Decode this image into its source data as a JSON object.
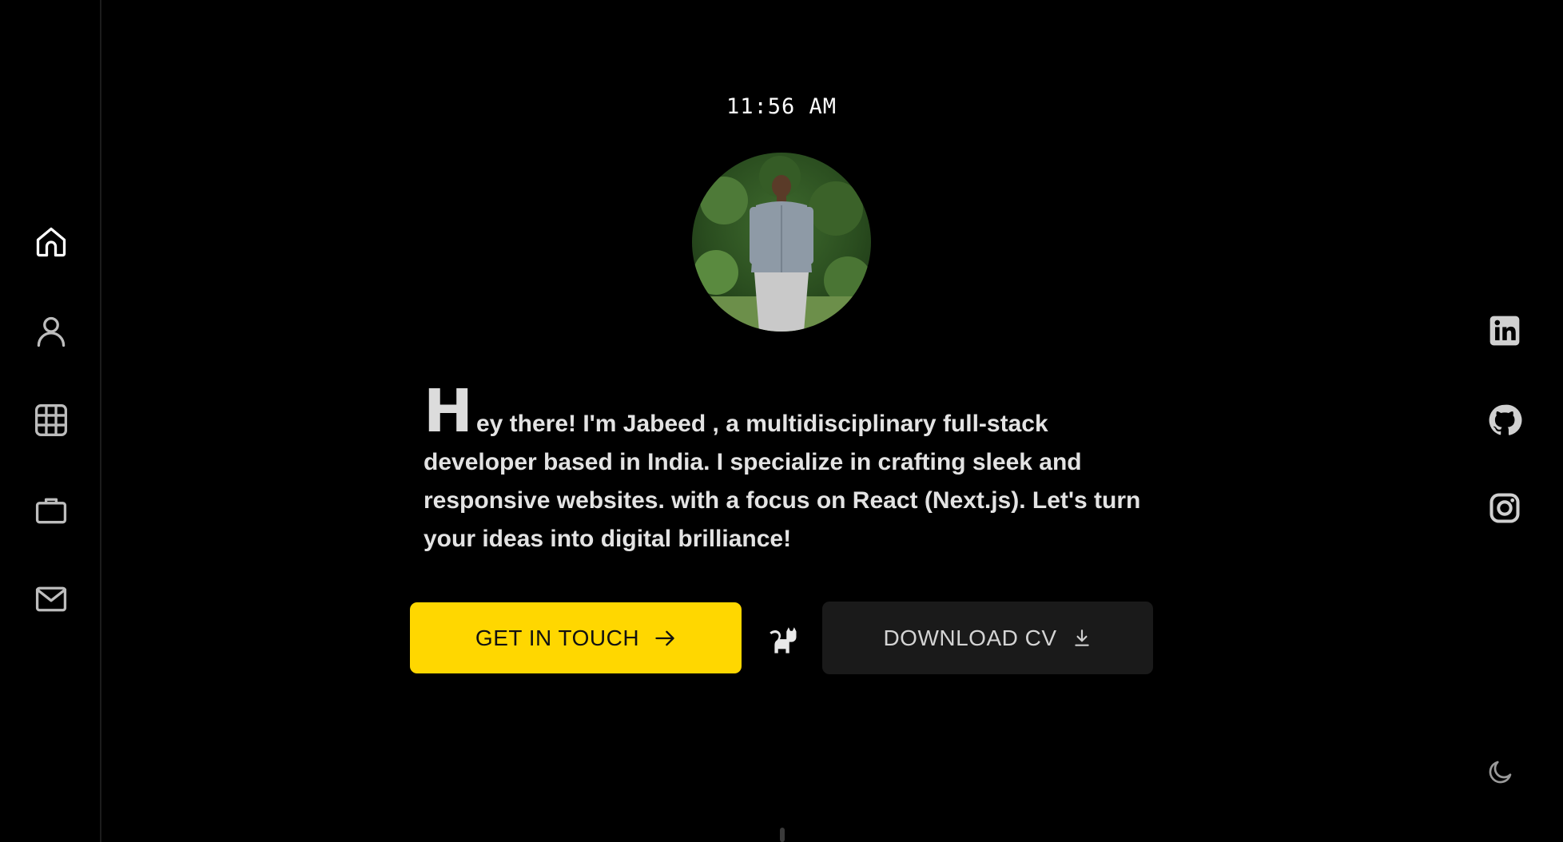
{
  "clock": {
    "time": "11:56 AM"
  },
  "sidebar": {
    "items": [
      {
        "name": "home",
        "icon": "home-icon",
        "active": true
      },
      {
        "name": "about",
        "icon": "user-icon",
        "active": false
      },
      {
        "name": "projects",
        "icon": "grid-icon",
        "active": false
      },
      {
        "name": "experience",
        "icon": "briefcase-icon",
        "active": false
      },
      {
        "name": "contact",
        "icon": "mail-icon",
        "active": false
      }
    ]
  },
  "hero": {
    "dropcap": "H",
    "intro": "ey there! I'm Jabeed , a multidisciplinary full-stack developer based in India. I specialize in crafting sleek and responsive websites. with a focus on React (Next.js). Let's turn your ideas into digital brilliance!"
  },
  "actions": {
    "primary_label": "GET IN TOUCH",
    "secondary_label": "DOWNLOAD CV"
  },
  "socials": [
    {
      "name": "linkedin",
      "icon": "linkedin-icon"
    },
    {
      "name": "github",
      "icon": "github-icon"
    },
    {
      "name": "instagram",
      "icon": "instagram-icon"
    }
  ],
  "colors": {
    "background": "#000000",
    "accent": "#ffd700",
    "secondary_button": "#1a1a1a",
    "text": "#e3e3e3"
  }
}
